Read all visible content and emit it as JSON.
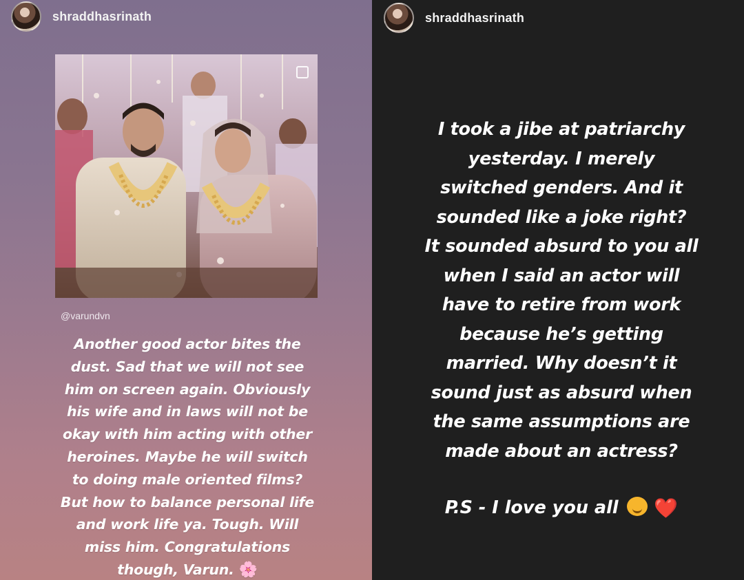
{
  "left_story": {
    "username": "shraddhasrinath",
    "mention": "@varundvn",
    "caption_lines": [
      "Another good actor bites the",
      "dust. Sad that we will not see",
      "him on screen again. Obviously",
      "his wife and in laws will not be",
      "okay with him acting with other",
      "heroines. Maybe he will switch",
      "to doing male oriented films?",
      "But how to balance personal life",
      "and work life ya. Tough. Will",
      "miss him. Congratulations",
      "though, Varun."
    ],
    "flower_emoji": "🌸"
  },
  "right_story": {
    "username": "shraddhasrinath",
    "caption_lines": [
      "I took a jibe at patriarchy",
      "yesterday. I merely",
      "switched genders. And it",
      "sounded like a joke right?",
      "It sounded absurd to you all",
      "when I said an actor will",
      "have to retire from work",
      "because he’s getting",
      "married. Why doesn’t it",
      "sound just as absurd when",
      "the same assumptions are",
      "made about an actress?"
    ],
    "ps_text": "P.S - I love you all",
    "heart_emoji": "❤️"
  },
  "icons": {
    "avatar_left": "avatar-icon",
    "avatar_right": "avatar-icon",
    "photo_corner": "square-outline-icon"
  },
  "colors": {
    "left_bg_top": "#7f6f8e",
    "left_bg_bottom": "#b88283",
    "right_bg": "#1f1f1f",
    "text": "#ffffff"
  }
}
